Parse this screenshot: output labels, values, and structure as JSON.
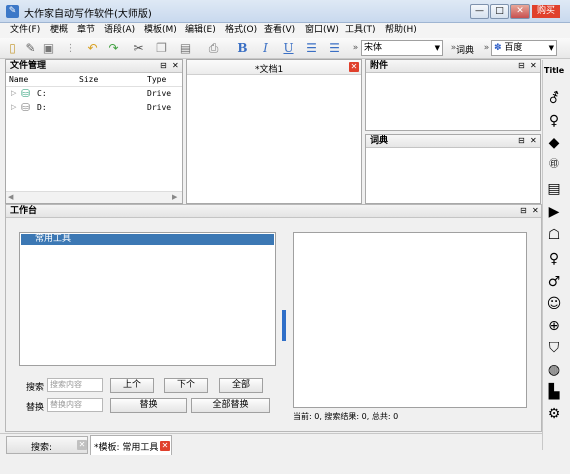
{
  "window": {
    "title": "大作家自动写作软件(大师版)",
    "buy_label": "购买",
    "min_symbol": "—",
    "max_symbol": "□",
    "close_symbol": "✕"
  },
  "menu": [
    "文件(F)",
    "梗概",
    "章节",
    "语段(A)",
    "模板(M)",
    "编辑(E)",
    "格式(O)",
    "查看(V)",
    "窗口(W)",
    "工具(T)",
    "帮助(H)"
  ],
  "toolbar": {
    "font_value": "宋体",
    "dict_label": "词典",
    "search_engine": "百度",
    "more_symbol": "»"
  },
  "file_panel": {
    "title": "文件管理",
    "columns": [
      "Name",
      "Size",
      "Type"
    ],
    "rows": [
      {
        "name": "C:",
        "type": "Drive"
      },
      {
        "name": "D:",
        "type": "Drive"
      }
    ]
  },
  "doc_tab": {
    "title": "*文档1"
  },
  "attach_panel": {
    "title": "附件"
  },
  "dict_panel": {
    "title": "词典"
  },
  "workbench": {
    "title": "工作台",
    "list_selected": "常用工具",
    "search_label": "搜索",
    "search_placeholder": "搜索内容",
    "replace_label": "替换",
    "replace_placeholder": "替换内容",
    "prev_label": "上个",
    "next_label": "下个",
    "all_label": "全部",
    "replace_btn": "替换",
    "replace_all_btn": "全部替换",
    "status": "当前: 0, 搜索结果: 0, 总共: 0"
  },
  "bottom_tabs": [
    {
      "label": "搜索:"
    },
    {
      "label": "*模板: 常用工具"
    }
  ],
  "right_bar": {
    "title_label": "Title"
  }
}
